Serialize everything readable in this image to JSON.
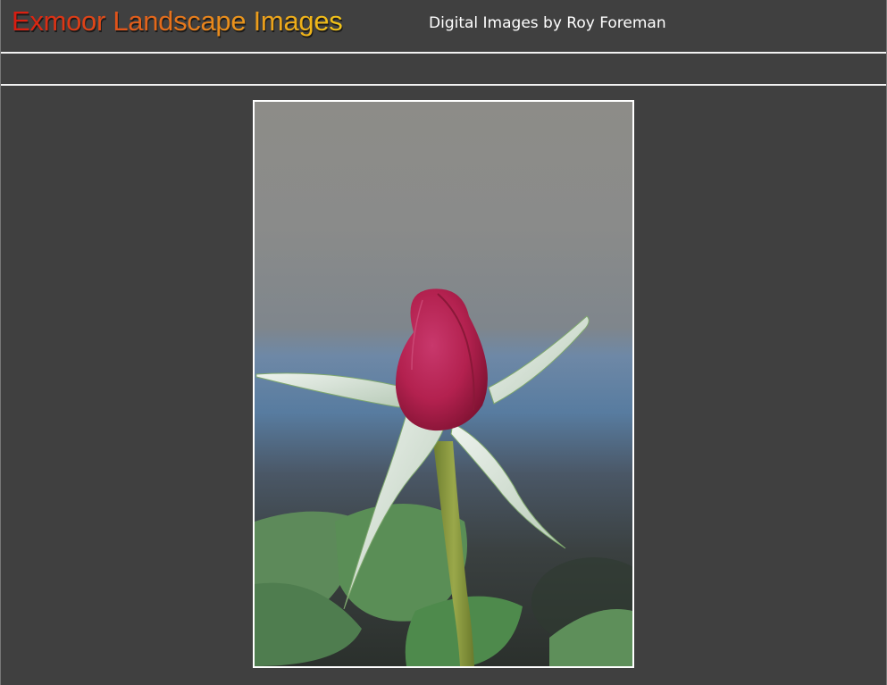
{
  "header": {
    "title": "Exmoor Landscape Images",
    "subtitle": "Digital Images by Roy Foreman"
  },
  "photo": {
    "subject": "rose-bud",
    "alt": ""
  },
  "colors": {
    "background": "#404040",
    "rule": "#f2f2f2",
    "title_gradient_start": "#d81a10",
    "title_gradient_end": "#f2c418",
    "subtitle": "#ffffff",
    "frame": "#ffffff"
  }
}
